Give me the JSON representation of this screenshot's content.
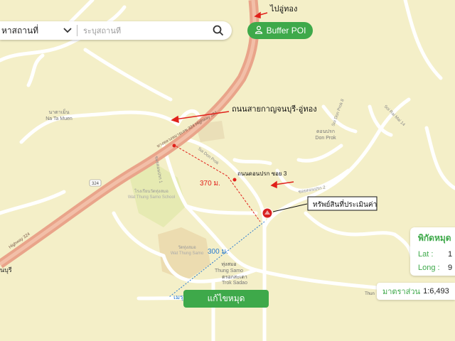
{
  "search": {
    "category": "หาสถานที่",
    "placeholder": "ระบุสถานที่"
  },
  "buffer_button": {
    "label": "Buffer POI",
    "icon": "person-icon"
  },
  "coordinates": {
    "title": "พิกัดหมุด",
    "lat_label": "Lat :",
    "lat_value": "1",
    "long_label": "Long :",
    "long_value": "9"
  },
  "scale": {
    "label": "มาตราส่วน",
    "value": "1:6,493"
  },
  "edit_button": {
    "label": "แก้ไขหมุด"
  },
  "annotations": {
    "to_uthong": "ไปอู่ทอง",
    "main_road": "ถนนสายกาญจนบุรี-อู่ทอง",
    "soi_3": "ถนนดอนปรก ซอย 3",
    "distance_soi": "370 ม.",
    "property": "ทรัพย์สินที่ประเมินค่า",
    "distance_market": "300 ม.",
    "market": "เมรุวัดทุ่งสมอ"
  },
  "map_labels": {
    "highway_top": "ทางหลวงหมายเลข 324 Highway 324",
    "highway_bottom": "Highway 324",
    "shield": "324",
    "na_ta_muen_th": "นาตาเม็น",
    "na_ta_muen_en": "Na Ta Muen",
    "don_prok_th": "ดอนปรก",
    "don_prok_en": "Don Prok",
    "soi_don_prok": "Soi Don Prok",
    "soi_rai_mai": "Soi Rai Mai 14",
    "soi_don_prok_8": "Soi Don Prok 8",
    "school_th": "โรงเรียนวัดทุ่งสมอ",
    "school_en": "Wat Thung Samo School",
    "temple_th": "วัดทุ่งสมอ",
    "temple_en": "Wat Thung Samo",
    "thung_samo_th": "ทุ่งสมอ",
    "thung_samo_en": "Thung Samo",
    "trok_sadao_th": "ตรอกสะเดา",
    "trok_sadao_en": "Trok Sadao",
    "buri": "นบุรี",
    "soi_don_prok_2": "ซอยดอนปรก 2",
    "soi_don_prok_1": "ซอยดอนปรก 1",
    "thun": "Thun"
  },
  "colors": {
    "map_bg": "#f4efc8",
    "highway": "#e9a48a",
    "road": "#ffffff",
    "accent": "#3ea94a",
    "annotation": "#e0201a",
    "distance_line": "#2a7bd0"
  }
}
